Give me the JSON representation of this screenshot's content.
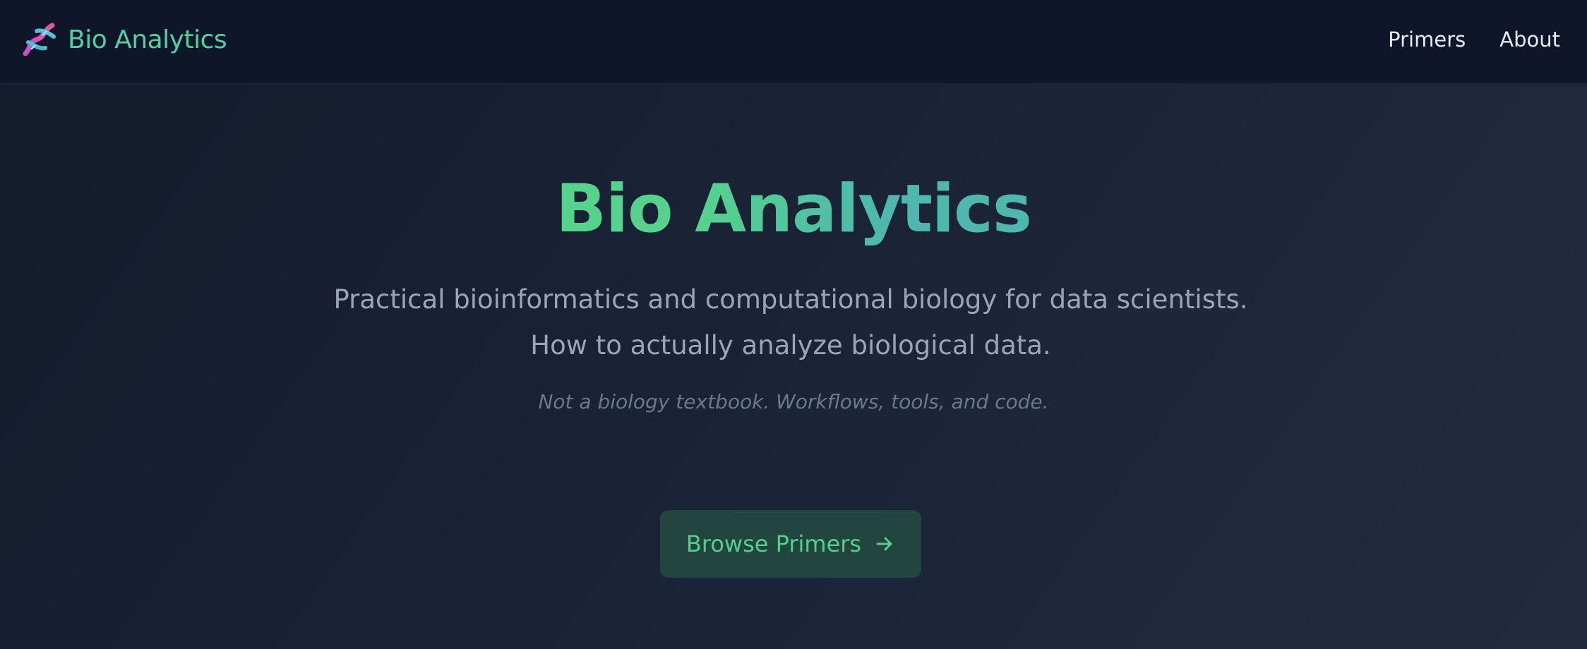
{
  "header": {
    "brand_name": "Bio Analytics",
    "brand_icon": "dna-icon",
    "nav": [
      {
        "label": "Primers"
      },
      {
        "label": "About"
      }
    ]
  },
  "hero": {
    "title": "Bio Analytics",
    "subtitle": "Practical bioinformatics and computational biology for data scientists. How to actually analyze biological data.",
    "note": "Not a biology textbook. Workflows, tools, and code.",
    "cta": {
      "label": "Browse Primers",
      "icon": "arrow-right-icon"
    }
  },
  "colors": {
    "accent": "#4fd1a0",
    "background": "#1a2235",
    "navbar": "#10162a",
    "button_bg": "#23453f"
  }
}
